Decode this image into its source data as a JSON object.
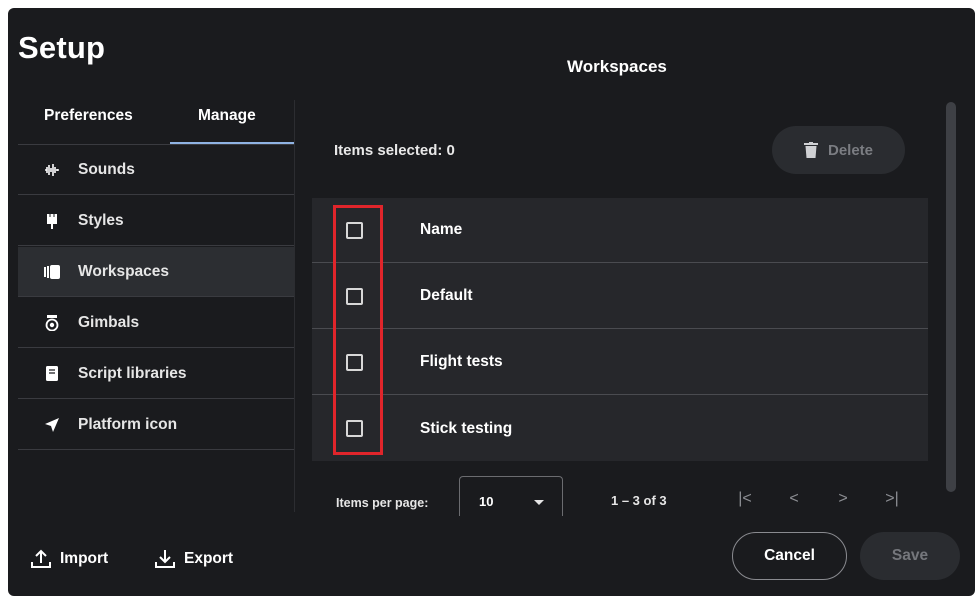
{
  "dialog": {
    "title": "Setup",
    "page_heading": "Workspaces"
  },
  "tabs": [
    {
      "label": "Preferences",
      "active": false
    },
    {
      "label": "Manage",
      "active": true
    }
  ],
  "sidebar": {
    "items": [
      {
        "label": "Sounds",
        "icon": "sound-wave-icon",
        "active": false
      },
      {
        "label": "Styles",
        "icon": "brush-icon",
        "active": false
      },
      {
        "label": "Workspaces",
        "icon": "workspace-icon",
        "active": true
      },
      {
        "label": "Gimbals",
        "icon": "gimbal-icon",
        "active": false
      },
      {
        "label": "Script libraries",
        "icon": "book-icon",
        "active": false
      },
      {
        "label": "Platform icon",
        "icon": "navigation-arrow-icon",
        "active": false
      }
    ]
  },
  "selection": {
    "label": "Items selected: 0"
  },
  "delete_button": {
    "label": "Delete",
    "icon": "trash-icon",
    "enabled": false
  },
  "table": {
    "header": "Name",
    "rows": [
      "Default",
      "Flight tests",
      "Stick testing"
    ]
  },
  "pagination": {
    "items_per_page_label": "Items per page:",
    "items_per_page_value": "10",
    "range": "1 – 3 of 3",
    "first_page_glyph": "|<",
    "prev_page_glyph": "<",
    "next_page_glyph": ">",
    "last_page_glyph": ">|"
  },
  "footer": {
    "import_label": "Import",
    "export_label": "Export",
    "cancel_label": "Cancel",
    "save_label": "Save"
  },
  "colors": {
    "background": "#1a1b1e",
    "table_bg": "#26272b",
    "active_tab_underline": "#8fb3e3",
    "highlight_box": "#e0252b",
    "disabled_text": "#75777c"
  }
}
